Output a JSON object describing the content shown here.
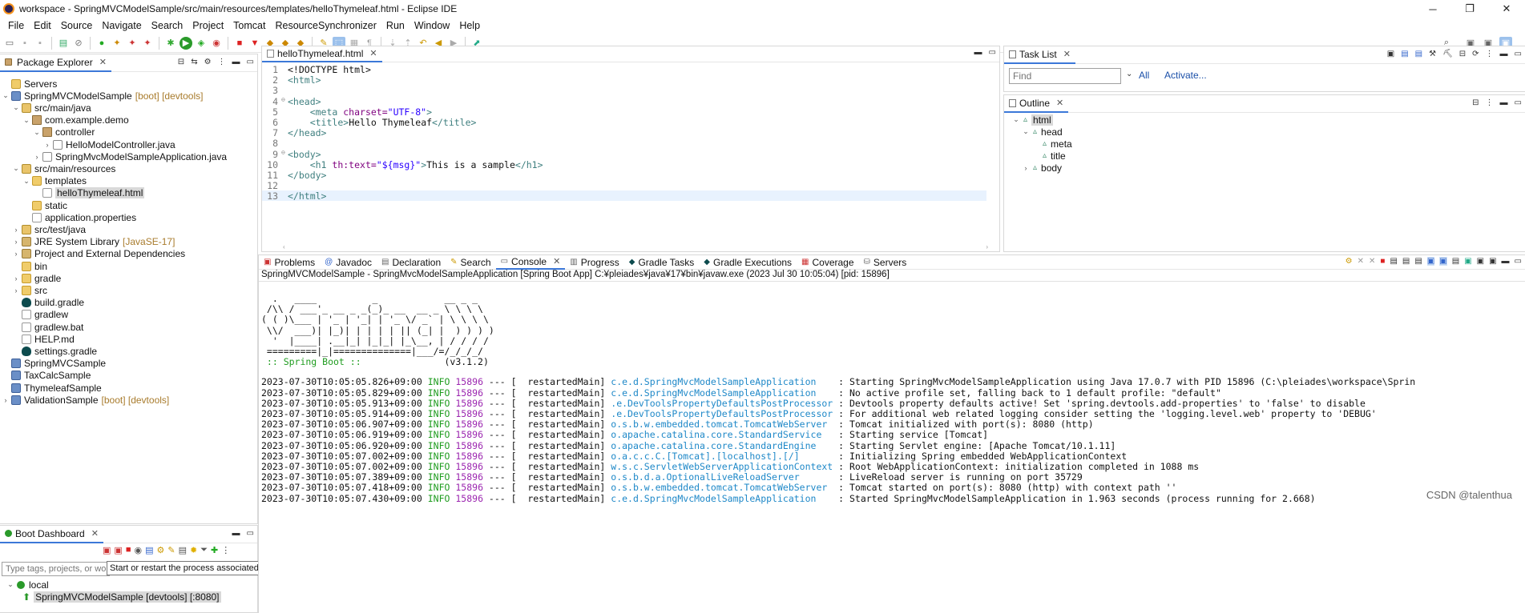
{
  "window": {
    "title": "workspace - SpringMVCModelSample/src/main/resources/templates/helloThymeleaf.html - Eclipse IDE",
    "minimize": "─",
    "restore": "❐",
    "close": "✕"
  },
  "menu": [
    "File",
    "Edit",
    "Source",
    "Navigate",
    "Search",
    "Project",
    "Tomcat",
    "ResourceSynchronizer",
    "Run",
    "Window",
    "Help"
  ],
  "package_explorer": {
    "tab_label": "Package Explorer",
    "items": [
      {
        "label": "Servers",
        "decoration": ""
      },
      {
        "label": "SpringMVCModelSample",
        "decoration": "[boot] [devtools]"
      },
      {
        "label": "src/main/java",
        "decoration": ""
      },
      {
        "label": "com.example.demo",
        "decoration": ""
      },
      {
        "label": "controller",
        "decoration": ""
      },
      {
        "label": "HelloModelController.java",
        "decoration": ""
      },
      {
        "label": "SpringMvcModelSampleApplication.java",
        "decoration": ""
      },
      {
        "label": "src/main/resources",
        "decoration": ""
      },
      {
        "label": "templates",
        "decoration": ""
      },
      {
        "label": "helloThymeleaf.html",
        "decoration": ""
      },
      {
        "label": "static",
        "decoration": ""
      },
      {
        "label": "application.properties",
        "decoration": ""
      },
      {
        "label": "src/test/java",
        "decoration": ""
      },
      {
        "label": "JRE System Library",
        "decoration": "[JavaSE-17]"
      },
      {
        "label": "Project and External Dependencies",
        "decoration": ""
      },
      {
        "label": "bin",
        "decoration": ""
      },
      {
        "label": "gradle",
        "decoration": ""
      },
      {
        "label": "src",
        "decoration": ""
      },
      {
        "label": "build.gradle",
        "decoration": ""
      },
      {
        "label": "gradlew",
        "decoration": ""
      },
      {
        "label": "gradlew.bat",
        "decoration": ""
      },
      {
        "label": "HELP.md",
        "decoration": ""
      },
      {
        "label": "settings.gradle",
        "decoration": ""
      },
      {
        "label": "SpringMVCSample",
        "decoration": ""
      },
      {
        "label": "TaxCalcSample",
        "decoration": ""
      },
      {
        "label": "ThymeleafSample",
        "decoration": ""
      },
      {
        "label": "ValidationSample",
        "decoration": "[boot] [devtools]"
      }
    ]
  },
  "boot_dashboard": {
    "tab_label": "Boot Dashboard",
    "filter_placeholder": "Type tags, projects, or working",
    "tooltip": "Start or restart the process associated with the selected elements (Ctrl+Alt+Shift+B, R)",
    "group": "local",
    "app": "SpringMVCModelSample [devtools] [:8080]"
  },
  "editor": {
    "tab_label": "helloThymeleaf.html",
    "lines": [
      {
        "n": "1",
        "text": "<!DOCTYPE html>"
      },
      {
        "n": "2",
        "text": "<html>"
      },
      {
        "n": "3",
        "text": ""
      },
      {
        "n": "4",
        "text": "<head>"
      },
      {
        "n": "5",
        "text": "    <meta charset=\"UTF-8\">"
      },
      {
        "n": "6",
        "text": "    <title>Hello Thymeleaf</title>"
      },
      {
        "n": "7",
        "text": "</head>"
      },
      {
        "n": "8",
        "text": ""
      },
      {
        "n": "9",
        "text": "<body>"
      },
      {
        "n": "10",
        "text": "    <h1 th:text=\"${msg}\">This is a sample</h1>"
      },
      {
        "n": "11",
        "text": "</body>"
      },
      {
        "n": "12",
        "text": ""
      },
      {
        "n": "13",
        "text": "</html>"
      }
    ]
  },
  "task_list": {
    "tab_label": "Task List",
    "find_placeholder": "Find",
    "all_label": "All",
    "activate_label": "Activate..."
  },
  "outline": {
    "tab_label": "Outline",
    "items": [
      "html",
      "head",
      "meta",
      "title",
      "body"
    ]
  },
  "bottom_tabs": [
    "Problems",
    "Javadoc",
    "Declaration",
    "Search",
    "Console",
    "Progress",
    "Gradle Tasks",
    "Gradle Executions",
    "Coverage",
    "Servers"
  ],
  "console": {
    "header": "SpringMVCModelSample - SpringMvcModelSampleApplication [Spring Boot App] C:¥pleiades¥java¥17¥bin¥javaw.exe  (2023 Jul 30 10:05:04) [pid: 15896]",
    "banner": [
      "  .   ____          _            __ _ _",
      " /\\\\ / ___'_ __ _ _(_)_ __  __ _ \\ \\ \\ \\",
      "( ( )\\___ | '_ | '_| | '_ \\/ _` | \\ \\ \\ \\",
      " \\\\/  ___)| |_)| | | | | || (_| |  ) ) ) )",
      "  '  |____| .__|_| |_|_| |_\\__, | / / / /",
      " =========|_|==============|___/=/_/_/_/"
    ],
    "boot_label": " :: Spring Boot :: ",
    "boot_version": "              (v3.1.2)",
    "logs": [
      {
        "ts": "2023-07-30T10:05:05.826+09:00",
        "lvl": "INFO",
        "pid": "15896",
        "thread": " --- [  restartedMain]",
        "logger": "c.e.d.SpringMvcModelSampleApplication   ",
        "msg": " : Starting SpringMvcModelSampleApplication using Java 17.0.7 with PID 15896 (C:\\pleiades\\workspace\\Sprin"
      },
      {
        "ts": "2023-07-30T10:05:05.829+09:00",
        "lvl": "INFO",
        "pid": "15896",
        "thread": " --- [  restartedMain]",
        "logger": "c.e.d.SpringMvcModelSampleApplication   ",
        "msg": " : No active profile set, falling back to 1 default profile: \"default\""
      },
      {
        "ts": "2023-07-30T10:05:05.913+09:00",
        "lvl": "INFO",
        "pid": "15896",
        "thread": " --- [  restartedMain]",
        "logger": ".e.DevToolsPropertyDefaultsPostProcessor",
        "msg": " : Devtools property defaults active! Set 'spring.devtools.add-properties' to 'false' to disable"
      },
      {
        "ts": "2023-07-30T10:05:05.914+09:00",
        "lvl": "INFO",
        "pid": "15896",
        "thread": " --- [  restartedMain]",
        "logger": ".e.DevToolsPropertyDefaultsPostProcessor",
        "msg": " : For additional web related logging consider setting the 'logging.level.web' property to 'DEBUG'"
      },
      {
        "ts": "2023-07-30T10:05:06.907+09:00",
        "lvl": "INFO",
        "pid": "15896",
        "thread": " --- [  restartedMain]",
        "logger": "o.s.b.w.embedded.tomcat.TomcatWebServer ",
        "msg": " : Tomcat initialized with port(s): 8080 (http)"
      },
      {
        "ts": "2023-07-30T10:05:06.919+09:00",
        "lvl": "INFO",
        "pid": "15896",
        "thread": " --- [  restartedMain]",
        "logger": "o.apache.catalina.core.StandardService  ",
        "msg": " : Starting service [Tomcat]"
      },
      {
        "ts": "2023-07-30T10:05:06.920+09:00",
        "lvl": "INFO",
        "pid": "15896",
        "thread": " --- [  restartedMain]",
        "logger": "o.apache.catalina.core.StandardEngine   ",
        "msg": " : Starting Servlet engine: [Apache Tomcat/10.1.11]"
      },
      {
        "ts": "2023-07-30T10:05:07.002+09:00",
        "lvl": "INFO",
        "pid": "15896",
        "thread": " --- [  restartedMain]",
        "logger": "o.a.c.c.C.[Tomcat].[localhost].[/]      ",
        "msg": " : Initializing Spring embedded WebApplicationContext"
      },
      {
        "ts": "2023-07-30T10:05:07.002+09:00",
        "lvl": "INFO",
        "pid": "15896",
        "thread": " --- [  restartedMain]",
        "logger": "w.s.c.ServletWebServerApplicationContext",
        "msg": " : Root WebApplicationContext: initialization completed in 1088 ms"
      },
      {
        "ts": "2023-07-30T10:05:07.389+09:00",
        "lvl": "INFO",
        "pid": "15896",
        "thread": " --- [  restartedMain]",
        "logger": "o.s.b.d.a.OptionalLiveReloadServer      ",
        "msg": " : LiveReload server is running on port 35729"
      },
      {
        "ts": "2023-07-30T10:05:07.418+09:00",
        "lvl": "INFO",
        "pid": "15896",
        "thread": " --- [  restartedMain]",
        "logger": "o.s.b.w.embedded.tomcat.TomcatWebServer ",
        "msg": " : Tomcat started on port(s): 8080 (http) with context path ''"
      },
      {
        "ts": "2023-07-30T10:05:07.430+09:00",
        "lvl": "INFO",
        "pid": "15896",
        "thread": " --- [  restartedMain]",
        "logger": "c.e.d.SpringMvcModelSampleApplication   ",
        "msg": " : Started SpringMvcModelSampleApplication in 1.963 seconds (process running for 2.668)"
      }
    ]
  },
  "watermark": "CSDN @talenthua",
  "colors": {
    "accent": "#3c78d8",
    "info": "#1f9c1f",
    "logger": "#1e88c8",
    "selection": "#d9d9d9"
  }
}
